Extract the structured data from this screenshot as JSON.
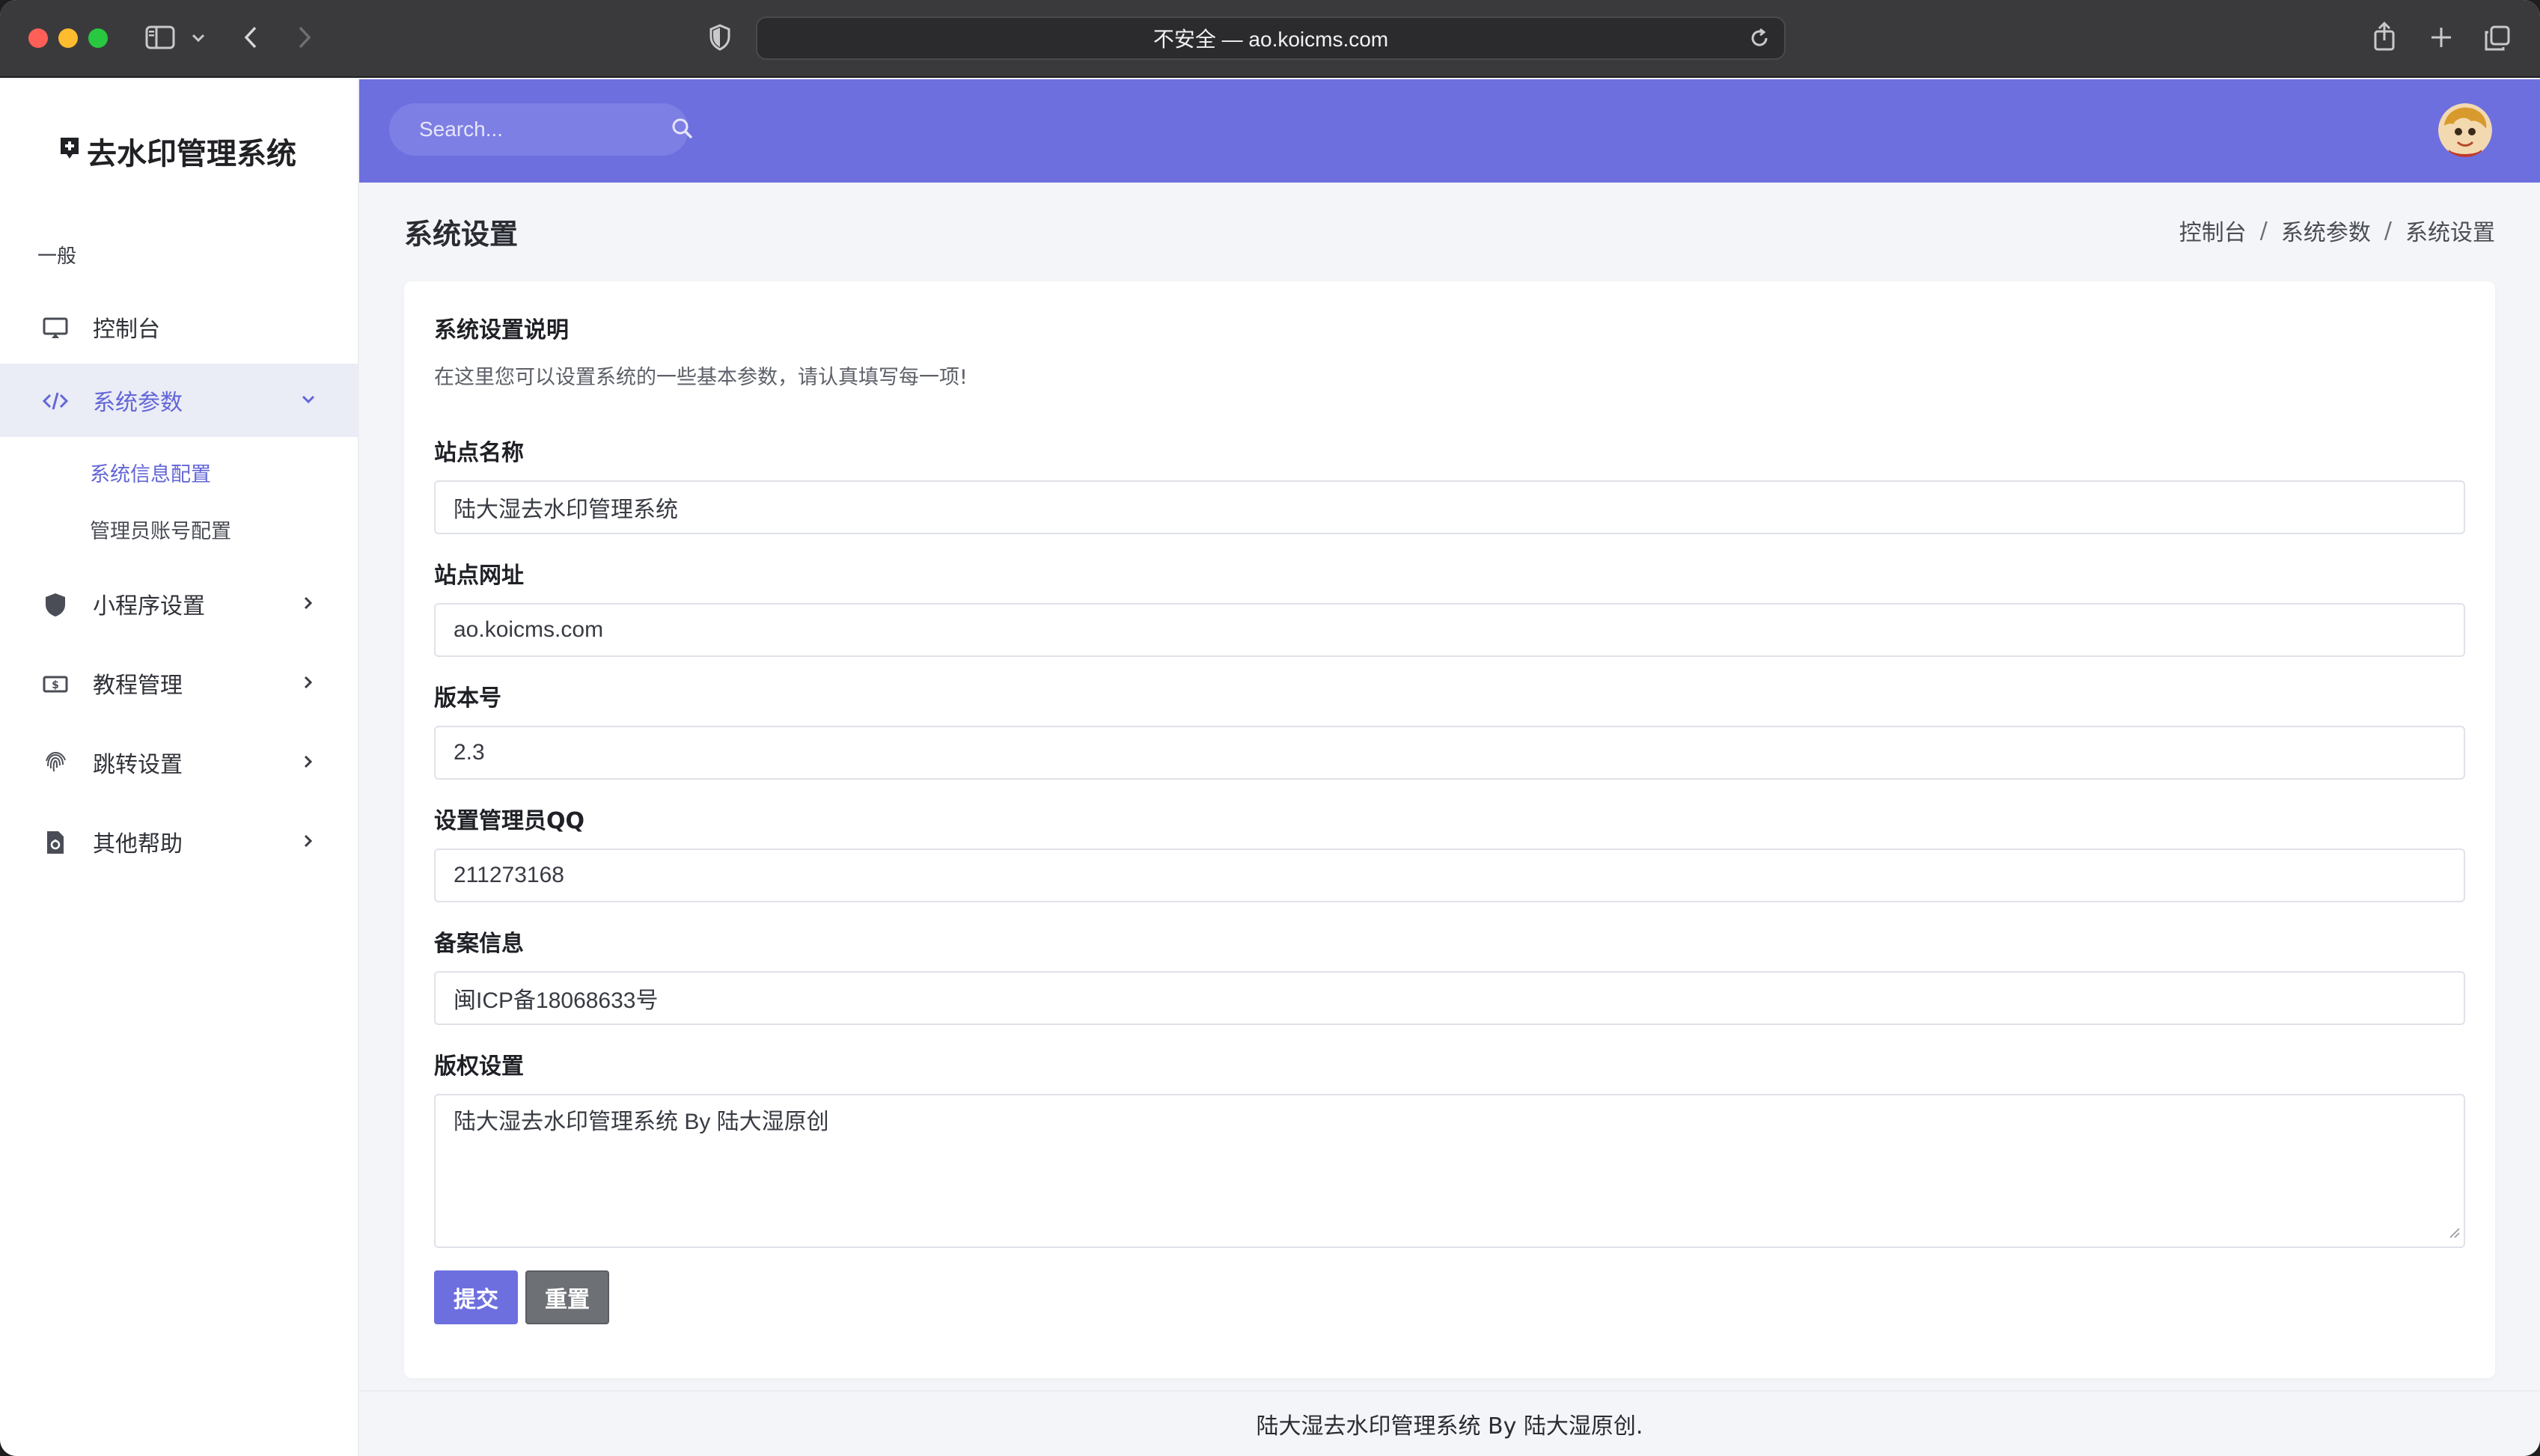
{
  "browser": {
    "url_text": "不安全 — ao.koicms.com"
  },
  "sidebar": {
    "brand": "去水印管理系统",
    "section": "一般",
    "items": [
      {
        "label": "控制台",
        "icon": "monitor-icon"
      },
      {
        "label": "系统参数",
        "icon": "code-icon",
        "active": true
      },
      {
        "label": "小程序设置",
        "icon": "shield-icon"
      },
      {
        "label": "教程管理",
        "icon": "money-icon"
      },
      {
        "label": "跳转设置",
        "icon": "fingerprint-icon"
      },
      {
        "label": "其他帮助",
        "icon": "file-icon"
      }
    ],
    "sub_items": [
      {
        "label": "系统信息配置",
        "active": true
      },
      {
        "label": "管理员账号配置"
      }
    ]
  },
  "topbar": {
    "search_placeholder": "Search..."
  },
  "page": {
    "title": "系统设置",
    "breadcrumb": [
      "控制台",
      "系统参数",
      "系统设置"
    ]
  },
  "form": {
    "title": "系统设置说明",
    "description": "在这里您可以设置系统的一些基本参数，请认真填写每一项!",
    "fields": [
      {
        "label": "站点名称",
        "value": "陆大湿去水印管理系统"
      },
      {
        "label": "站点网址",
        "value": "ao.koicms.com"
      },
      {
        "label": "版本号",
        "value": "2.3"
      },
      {
        "label": "设置管理员QQ",
        "value": "211273168"
      },
      {
        "label": "备案信息",
        "value": "闽ICP备18068633号"
      },
      {
        "label": "版权设置",
        "value": "陆大湿去水印管理系统 By 陆大湿原创"
      }
    ],
    "submit_label": "提交",
    "reset_label": "重置"
  },
  "footer": {
    "text": "陆大湿去水印管理系统 By 陆大湿原创."
  },
  "colors": {
    "accent": "#6d6fdf",
    "sidebar_active_bg": "#eaecf6",
    "reset_button": "#6d7176"
  }
}
